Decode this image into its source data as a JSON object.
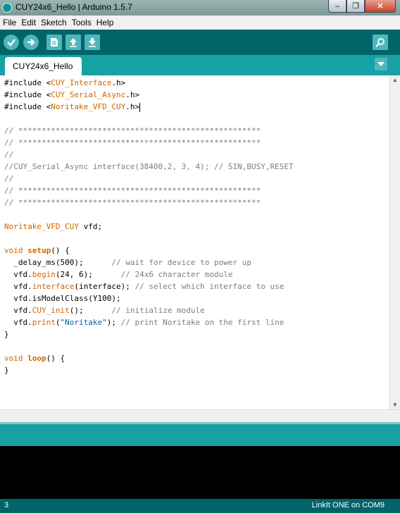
{
  "window": {
    "title": "CUY24x6_Hello | Arduino 1.5.7",
    "buttons": {
      "minimize": "–",
      "maximize": "❐",
      "close": "✕"
    }
  },
  "menu": [
    "File",
    "Edit",
    "Sketch",
    "Tools",
    "Help"
  ],
  "toolbar": {
    "icons": [
      "verify-icon",
      "upload-icon",
      "new-icon",
      "open-icon",
      "save-icon",
      "serial-monitor-icon"
    ]
  },
  "tabs": [
    {
      "label": "CUY24x6_Hello"
    }
  ],
  "code": {
    "lines": [
      [
        {
          "t": "#include <"
        },
        {
          "t": "CUY_Interface",
          "c": "fn"
        },
        {
          "t": ".h>"
        }
      ],
      [
        {
          "t": "#include <"
        },
        {
          "t": "CUY_Serial_Async",
          "c": "fn"
        },
        {
          "t": ".h>"
        }
      ],
      [
        {
          "t": "#include <"
        },
        {
          "t": "Noritake_VFD_CUY",
          "c": "fn"
        },
        {
          "t": ".h>"
        },
        {
          "cursor": true
        }
      ],
      [],
      [
        {
          "t": "// ****************************************************",
          "c": "cm"
        }
      ],
      [
        {
          "t": "// ****************************************************",
          "c": "cm"
        }
      ],
      [
        {
          "t": "//",
          "c": "cm"
        }
      ],
      [
        {
          "t": "//CUY_Serial_Async interface(38400,2, 3, 4); // SIN,BUSY,RESET",
          "c": "cm"
        }
      ],
      [
        {
          "t": "//",
          "c": "cm"
        }
      ],
      [
        {
          "t": "// ****************************************************",
          "c": "cm"
        }
      ],
      [
        {
          "t": "// ****************************************************",
          "c": "cm"
        }
      ],
      [],
      [
        {
          "t": "Noritake_VFD_CUY",
          "c": "fn"
        },
        {
          "t": " vfd;"
        }
      ],
      [],
      [
        {
          "t": "void",
          "c": "fn"
        },
        {
          "t": " "
        },
        {
          "t": "setup",
          "c": "kw"
        },
        {
          "t": "() {"
        }
      ],
      [
        {
          "t": "  _delay_ms(500);      "
        },
        {
          "t": "// wait for device to power up",
          "c": "cm"
        }
      ],
      [
        {
          "t": "  vfd."
        },
        {
          "t": "begin",
          "c": "fn"
        },
        {
          "t": "(24, 6);      "
        },
        {
          "t": "// 24x6 character module",
          "c": "cm"
        }
      ],
      [
        {
          "t": "  vfd."
        },
        {
          "t": "interface",
          "c": "fn"
        },
        {
          "t": "(interface); "
        },
        {
          "t": "// select which interface to use",
          "c": "cm"
        }
      ],
      [
        {
          "t": "  vfd.isModelClass(Y100);"
        }
      ],
      [
        {
          "t": "  vfd."
        },
        {
          "t": "CUY_init",
          "c": "fn"
        },
        {
          "t": "();      "
        },
        {
          "t": "// initialize module",
          "c": "cm"
        }
      ],
      [
        {
          "t": "  vfd."
        },
        {
          "t": "print",
          "c": "fn"
        },
        {
          "t": "("
        },
        {
          "t": "\"Noritake\"",
          "c": "st"
        },
        {
          "t": "); "
        },
        {
          "t": "// print Noritake on the first line",
          "c": "cm"
        }
      ],
      [
        {
          "t": "}"
        }
      ],
      [],
      [
        {
          "t": "void",
          "c": "fn"
        },
        {
          "t": " "
        },
        {
          "t": "loop",
          "c": "kw"
        },
        {
          "t": "() {"
        }
      ],
      [
        {
          "t": "}"
        }
      ]
    ]
  },
  "status": {
    "line": "3",
    "board": "LinkIt ONE on COM9"
  },
  "colors": {
    "toolbar": "#006468",
    "tab_bar": "#17a1a5",
    "keyword": "#cc6600",
    "comment": "#7e7e7e",
    "string": "#006699"
  }
}
